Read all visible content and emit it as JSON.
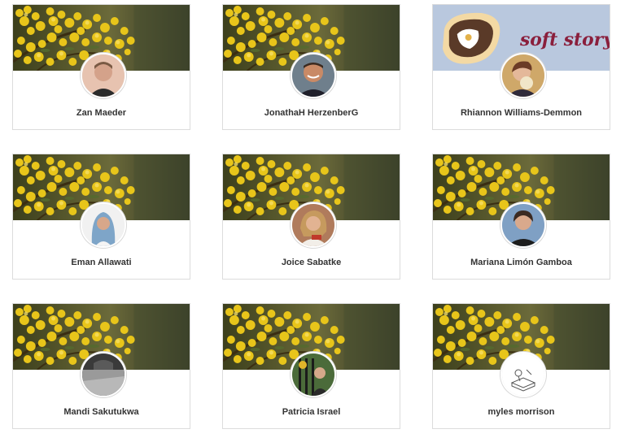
{
  "banner_overlay_text": "soft story",
  "people": [
    {
      "name": "Zan Maeder",
      "avatar": "avatar-zan-maeder"
    },
    {
      "name": "JonathaH HerzenberG",
      "avatar": "avatar-jonathah-herzenberg"
    },
    {
      "name": "Rhiannon Williams-Demmon",
      "avatar": "avatar-rhiannon-williams-demmon"
    },
    {
      "name": "Eman Allawati",
      "avatar": "avatar-eman-allawati"
    },
    {
      "name": "Joice Sabatke",
      "avatar": "avatar-joice-sabatke"
    },
    {
      "name": "Mariana Limón Gamboa",
      "avatar": "avatar-mariana-limon-gamboa"
    },
    {
      "name": "Mandi Sakutukwa",
      "avatar": "avatar-mandi-sakutukwa"
    },
    {
      "name": "Patricia Israel",
      "avatar": "avatar-patricia-israel"
    },
    {
      "name": "myles morrison",
      "avatar": "avatar-myles-morrison"
    }
  ],
  "colors": {
    "card_border": "#dcdcdc",
    "name_text": "#333333",
    "mimosa_yellow": "#e8c51a",
    "soft_story_text": "#8a1f3c",
    "soft_story_bg": "#b9c8de"
  }
}
